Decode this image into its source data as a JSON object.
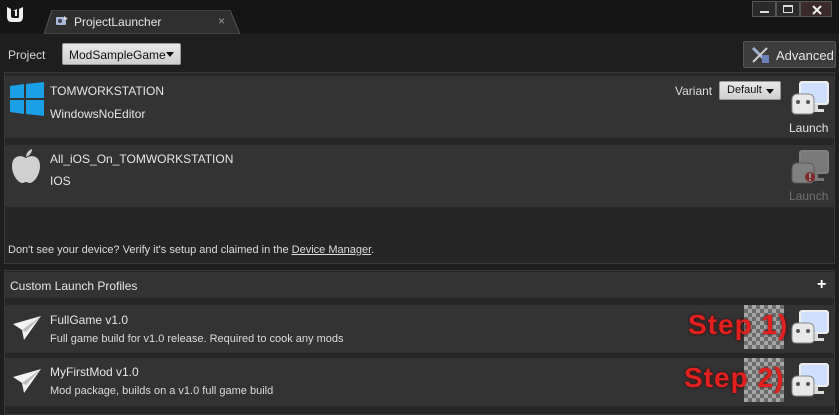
{
  "window": {
    "tab_title": "ProjectLauncher",
    "tab_close": "×"
  },
  "toolbar": {
    "project_label": "Project",
    "project_value": "ModSampleGame",
    "advanced_label": "Advanced"
  },
  "devices": {
    "items": [
      {
        "name": "TOMWORKSTATION",
        "platform": "WindowsNoEditor",
        "variant_label": "Variant",
        "variant_value": "Default",
        "launch_label": "Launch"
      },
      {
        "name": "All_iOS_On_TOMWORKSTATION",
        "platform": "IOS",
        "launch_label": "Launch"
      }
    ],
    "help_prefix": "Don't see your device? Verify it's setup and claimed in the ",
    "help_link": "Device Manager",
    "help_suffix": "."
  },
  "profiles": {
    "title": "Custom Launch Profiles",
    "add_symbol": "+",
    "items": [
      {
        "name": "FullGame v1.0",
        "description": "Full game build for v1.0 release. Required to cook any mods",
        "annotation": "Step 1)"
      },
      {
        "name": "MyFirstMod v1.0",
        "description": "Mod package, builds on a v1.0 full game build",
        "annotation": "Step 2)"
      }
    ]
  },
  "colors": {
    "background": "#1e1e1e",
    "row": "#333333",
    "windows_blue": "#1aa0e6",
    "step_red": "#e32020"
  },
  "icons": {
    "logo": "unreal-logo-icon",
    "tab": "project-launcher-icon",
    "windows": "windows-icon",
    "apple": "apple-icon",
    "launch": "gamepad-monitor-icon",
    "profile": "paper-plane-icon",
    "advanced": "advanced-tools-icon"
  }
}
